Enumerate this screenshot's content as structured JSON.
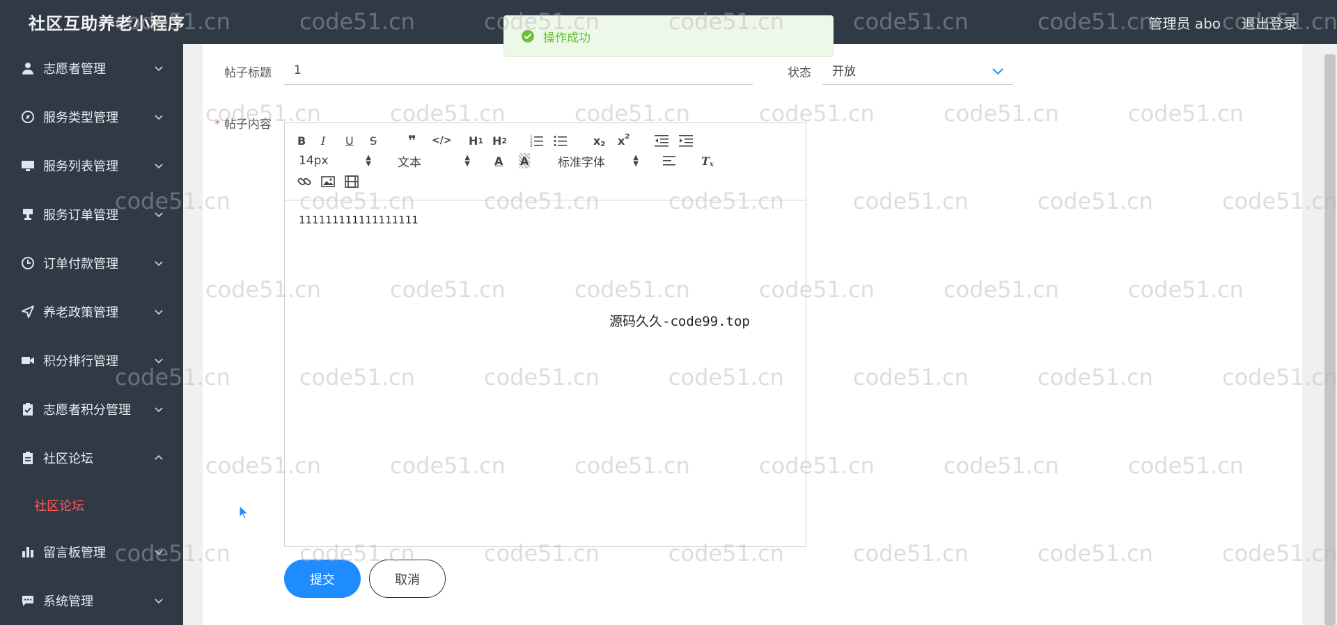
{
  "header": {
    "brand": "社区互助养老小程序",
    "user": "管理员 abo",
    "logout": "退出登录"
  },
  "sidebar": {
    "items": [
      {
        "label": "志愿者管理",
        "icon": "user-icon"
      },
      {
        "label": "服务类型管理",
        "icon": "compass-icon"
      },
      {
        "label": "服务列表管理",
        "icon": "monitor-icon"
      },
      {
        "label": "服务订单管理",
        "icon": "stamp-icon"
      },
      {
        "label": "订单付款管理",
        "icon": "clock-icon"
      },
      {
        "label": "养老政策管理",
        "icon": "send-icon"
      },
      {
        "label": "积分排行管理",
        "icon": "video-camera-icon"
      },
      {
        "label": "志愿者积分管理",
        "icon": "clipboard-check-icon"
      },
      {
        "label": "社区论坛",
        "icon": "clipboard-icon"
      },
      {
        "label": "留言板管理",
        "icon": "bar-chart-icon"
      },
      {
        "label": "系统管理",
        "icon": "chat-icon"
      }
    ],
    "active_sub": "社区论坛"
  },
  "form": {
    "title_label": "帖子标题",
    "title_value": "1",
    "status_label": "状态",
    "status_value": "开放",
    "content_label": "帖子内容",
    "required_mark": "*"
  },
  "editor": {
    "font_size": "14px",
    "paragraph": "文本",
    "font_family": "标准字体",
    "content": "111111111111111111"
  },
  "buttons": {
    "submit": "提交",
    "cancel": "取消"
  },
  "toast": {
    "message": "操作成功"
  },
  "overlay": {
    "text": "源码久久-code99.top"
  },
  "watermark": {
    "text": "code51.cn"
  },
  "colors": {
    "sidebar_bg": "#2f3a45",
    "accent": "#1e8bff",
    "active": "#ff5a5a",
    "success": "#67c23a"
  }
}
